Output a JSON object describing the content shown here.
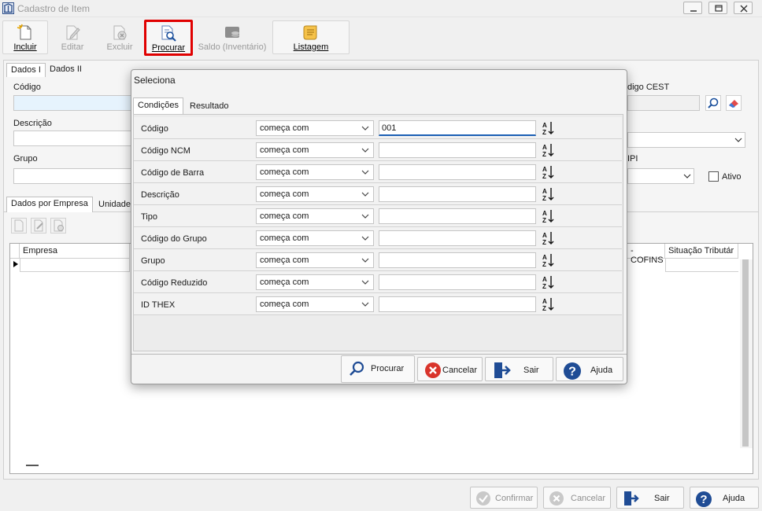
{
  "window": {
    "title": "Cadastro de Item"
  },
  "toolbar": {
    "incluir": "Incluir",
    "editar": "Editar",
    "excluir": "Excluir",
    "procurar": "Procurar",
    "saldo": "Saldo (Inventário)",
    "listagem": "Listagem"
  },
  "form": {
    "tabs": [
      "Dados I",
      "Dados II"
    ],
    "codigo_label": "Código",
    "descricao_label": "Descrição",
    "grupo_label": "Grupo",
    "cest_label": "digo CEST",
    "ipi_label": "IPI",
    "ativo_label": "Ativo",
    "subtabs": [
      "Dados por Empresa",
      "Unidade"
    ],
    "grid_headers": [
      "Empresa",
      "- COFINS",
      "Situação Tributár"
    ]
  },
  "bottom": {
    "confirmar": "Confirmar",
    "cancelar": "Cancelar",
    "sair": "Sair",
    "ajuda": "Ajuda"
  },
  "dialog": {
    "title": "Seleciona",
    "tabs": [
      "Condições",
      "Resultado"
    ],
    "conditions": [
      {
        "field": "Código",
        "operator": "começa com",
        "value": "001"
      },
      {
        "field": "Código NCM",
        "operator": "começa com",
        "value": ""
      },
      {
        "field": "Código de Barra",
        "operator": "começa com",
        "value": ""
      },
      {
        "field": "Descrição",
        "operator": "começa com",
        "value": ""
      },
      {
        "field": "Tipo",
        "operator": "começa com",
        "value": ""
      },
      {
        "field": "Código do Grupo",
        "operator": "começa com",
        "value": ""
      },
      {
        "field": "Grupo",
        "operator": "começa com",
        "value": ""
      },
      {
        "field": "Código Reduzido",
        "operator": "começa com",
        "value": ""
      },
      {
        "field": "ID THEX",
        "operator": "começa com",
        "value": ""
      }
    ],
    "buttons": {
      "procurar": "Procurar",
      "cancelar": "Cancelar",
      "sair": "Sair",
      "ajuda": "Ajuda"
    }
  },
  "colors": {
    "highlight": "#e00000",
    "accent": "#1a5fb4",
    "cancel_red": "#d9342b"
  }
}
